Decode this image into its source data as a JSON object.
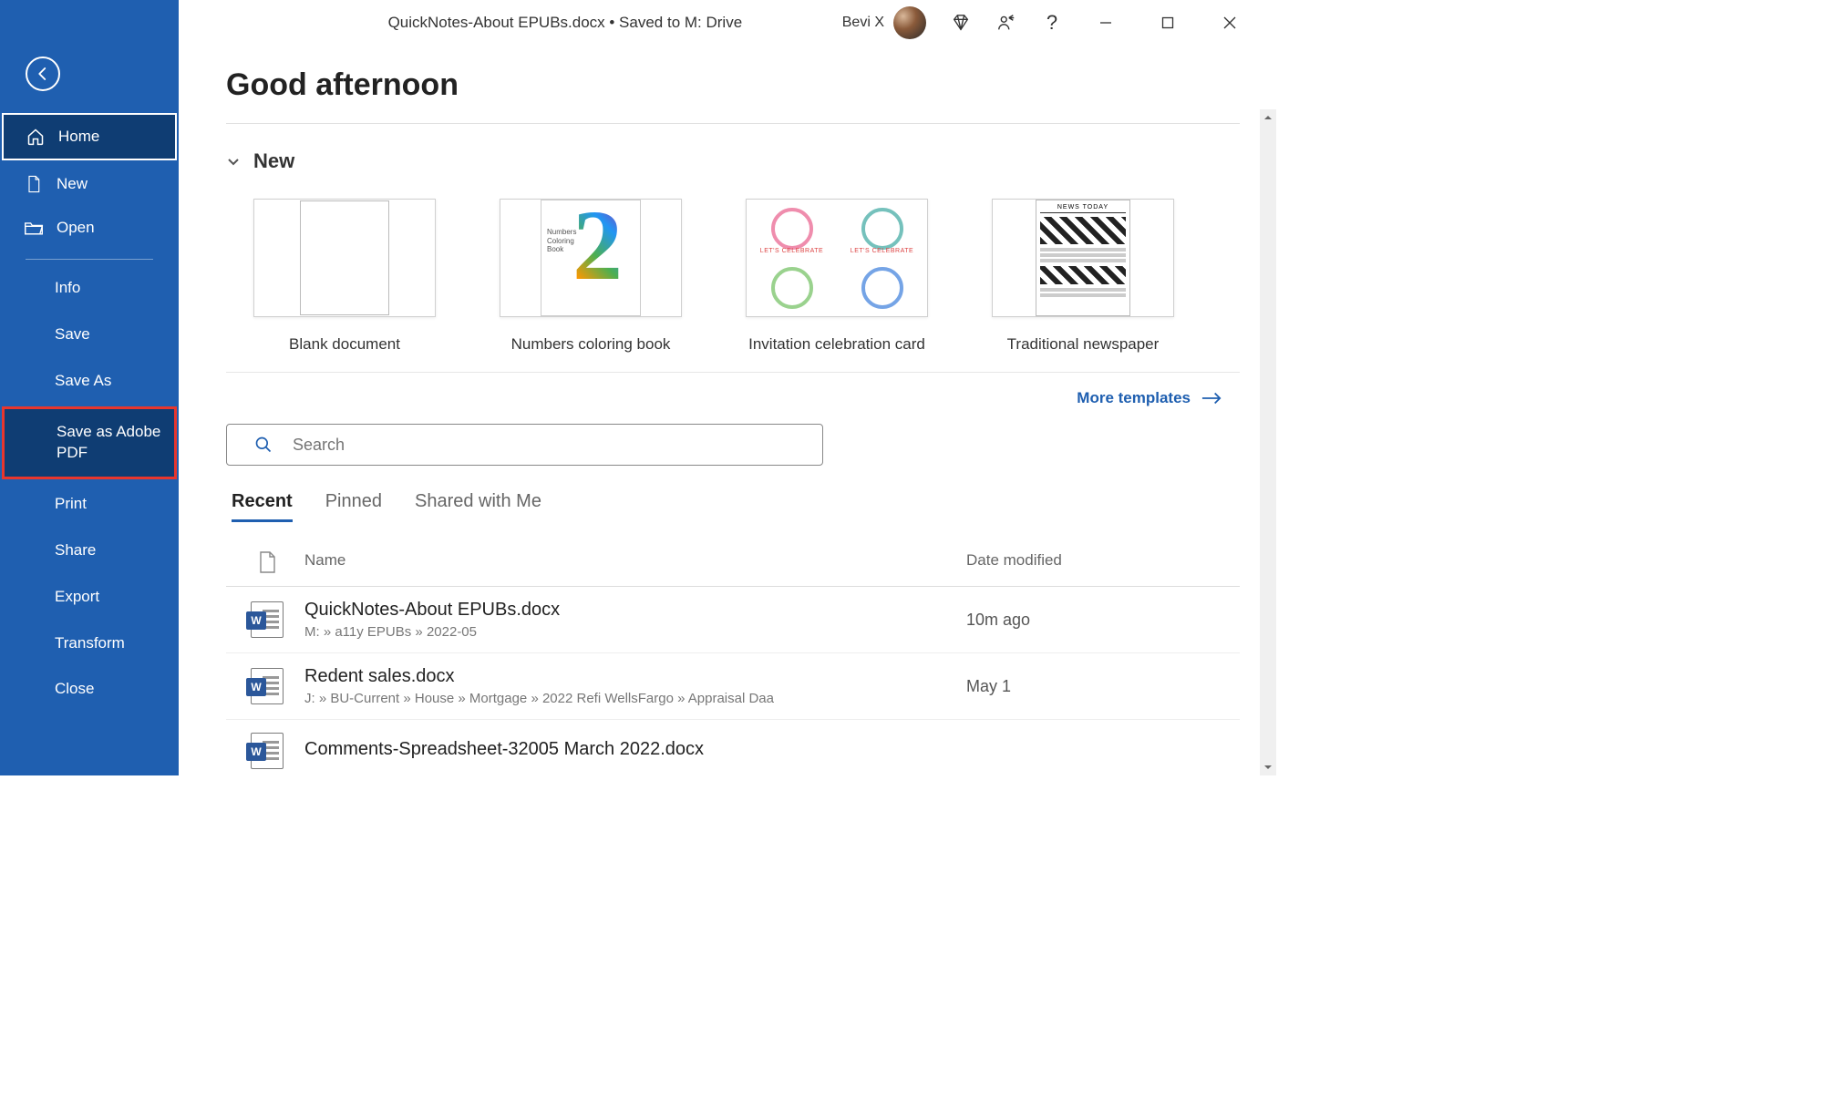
{
  "titlebar": {
    "document": "QuickNotes-About EPUBs.docx • Saved to M: Drive",
    "user_name": "Bevi X",
    "help_label": "?"
  },
  "sidebar": {
    "home": "Home",
    "new": "New",
    "open": "Open",
    "info": "Info",
    "save": "Save",
    "save_as": "Save As",
    "save_as_adobe_pdf": "Save as Adobe PDF",
    "print": "Print",
    "share": "Share",
    "export": "Export",
    "transform": "Transform",
    "close": "Close"
  },
  "main": {
    "greeting": "Good afternoon",
    "new_section": "New",
    "templates": [
      {
        "label": "Blank document"
      },
      {
        "label": "Numbers coloring book"
      },
      {
        "label": "Invitation celebration card"
      },
      {
        "label": "Traditional newspaper"
      }
    ],
    "coloring_caption": "Numbers Coloring Book",
    "invite_caption": "LET'S CELEBRATE",
    "news_caption": "NEWS TODAY",
    "more_templates": "More templates",
    "search_placeholder": "Search",
    "tabs": {
      "recent": "Recent",
      "pinned": "Pinned",
      "shared": "Shared with Me"
    },
    "table": {
      "name_header": "Name",
      "date_header": "Date modified"
    },
    "files": [
      {
        "name": "QuickNotes-About EPUBs.docx",
        "path": "M: » a11y EPUBs » 2022-05",
        "date": "10m ago"
      },
      {
        "name": "Redent sales.docx",
        "path": "J: » BU-Current » House » Mortgage » 2022 Refi WellsFargo » Appraisal Daa",
        "date": "May 1"
      },
      {
        "name": "Comments-Spreadsheet-32005 March 2022.docx",
        "path": "",
        "date": ""
      }
    ]
  }
}
